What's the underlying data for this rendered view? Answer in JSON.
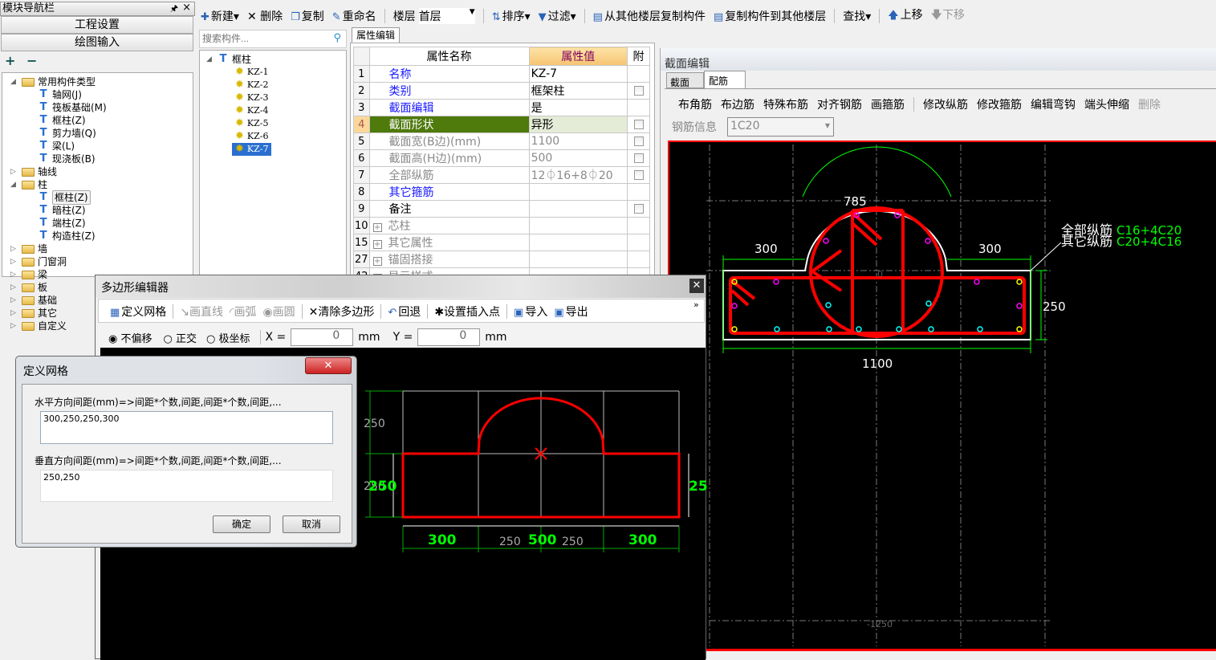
{
  "nav": {
    "title": "模块导航栏",
    "pin": "🖈",
    "close": "×",
    "project_settings": "工程设置",
    "drawing_input": "绘图输入",
    "expand": "+",
    "collapse": "−",
    "tree": [
      {
        "label": "常用构件类型",
        "level": 0,
        "expanded": true
      },
      {
        "label": "轴网(J)",
        "level": 1
      },
      {
        "label": "筏板基础(M)",
        "level": 1
      },
      {
        "label": "框柱(Z)",
        "level": 1
      },
      {
        "label": "剪力墙(Q)",
        "level": 1
      },
      {
        "label": "梁(L)",
        "level": 1
      },
      {
        "label": "现浇板(B)",
        "level": 1
      },
      {
        "label": "轴线",
        "level": 0
      },
      {
        "label": "柱",
        "level": 0,
        "expanded": true
      },
      {
        "label": "框柱(Z)",
        "level": 1,
        "selected": true
      },
      {
        "label": "暗柱(Z)",
        "level": 1
      },
      {
        "label": "端柱(Z)",
        "level": 1
      },
      {
        "label": "构造柱(Z)",
        "level": 1
      },
      {
        "label": "墙",
        "level": 0
      },
      {
        "label": "门窗洞",
        "level": 0
      },
      {
        "label": "梁",
        "level": 0
      },
      {
        "label": "板",
        "level": 0
      },
      {
        "label": "基础",
        "level": 0
      },
      {
        "label": "其它",
        "level": 0
      },
      {
        "label": "自定义",
        "level": 0
      }
    ]
  },
  "toolbar": {
    "new": "新建",
    "delete": "删除",
    "copy": "复制",
    "rename": "重命名",
    "floor_label": "楼层",
    "floor_value": "首层",
    "sort": "排序",
    "filter": "过滤",
    "copy_from_floor": "从其他楼层复制构件",
    "copy_to_floor": "复制构件到其他楼层",
    "find": "查找",
    "move_up": "上移",
    "move_down": "下移"
  },
  "components": {
    "search_placeholder": "搜索构件...",
    "root": "框柱",
    "items": [
      "KZ-1",
      "KZ-2",
      "KZ-3",
      "KZ-4",
      "KZ-5",
      "KZ-6",
      "KZ-7"
    ],
    "selected": "KZ-7"
  },
  "properties": {
    "tab": "属性编辑",
    "headers": {
      "name": "属性名称",
      "value": "属性值",
      "attach": "附"
    },
    "rows": [
      {
        "n": "1",
        "name": "名称",
        "value": "KZ-7"
      },
      {
        "n": "2",
        "name": "类别",
        "value": "框架柱"
      },
      {
        "n": "3",
        "name": "截面编辑",
        "value": "是"
      },
      {
        "n": "4",
        "name": "截面形状",
        "value": "异形"
      },
      {
        "n": "5",
        "name": "截面宽(B边)(mm)",
        "value": "1100"
      },
      {
        "n": "6",
        "name": "截面高(H边)(mm)",
        "value": "500"
      },
      {
        "n": "7",
        "name": "全部纵筋",
        "value": "12⏀16+8⏀20"
      },
      {
        "n": "8",
        "name": "其它箍筋",
        "value": ""
      },
      {
        "n": "9",
        "name": "备注",
        "value": ""
      },
      {
        "n": "10",
        "name": "芯柱",
        "value": ""
      },
      {
        "n": "15",
        "name": "其它属性",
        "value": ""
      },
      {
        "n": "27",
        "name": "锚固搭接",
        "value": ""
      },
      {
        "n": "42",
        "name": "显示样式",
        "value": ""
      }
    ]
  },
  "section_editor": {
    "title": "截面编辑",
    "tabs": [
      "截面",
      "配筋"
    ],
    "active_tab": "配筋",
    "tools": [
      "布角筋",
      "布边筋",
      "特殊布筋",
      "对齐钢筋",
      "画箍筋",
      "修改纵筋",
      "修改箍筋",
      "编辑弯钩",
      "端头伸缩",
      "删除"
    ],
    "rebar_info_label": "钢筋信息",
    "rebar_info_value": "1C20",
    "canvas": {
      "dim_left": "300",
      "dim_right": "300",
      "dim_arc": "785",
      "dim_height": "250",
      "dim_width": "1100",
      "label_all": "全部纵筋",
      "label_all_value": "C16+4C20",
      "label_other": "其它纵筋",
      "label_other_value": "C20+4C16",
      "origin": "0",
      "coord": "-1250"
    }
  },
  "polygon_editor": {
    "title": "多边形编辑器",
    "tools": {
      "define_grid": "定义网格",
      "line": "画直线",
      "arc": "画弧",
      "circle": "画圆",
      "clear": "清除多边形",
      "undo": "回退",
      "insert_point": "设置插入点",
      "import": "导入",
      "export": "导出"
    },
    "modes": [
      "不偏移",
      "正交",
      "极坐标"
    ],
    "selected_mode": "不偏移",
    "x_label": "X =",
    "x_value": "0",
    "y_label": "Y =",
    "y_value": "0",
    "unit": "mm",
    "canvas": {
      "v1": "250",
      "v2": "250",
      "v_green": "250",
      "v_right": "25",
      "h1": "300",
      "h2": "500",
      "h3": "300",
      "hg1": "250",
      "hg2": "250"
    }
  },
  "grid_dialog": {
    "title": "定义网格",
    "h_label": "水平方向间距(mm)=>间距*个数,间距,间距*个数,间距,...",
    "h_value": "300,250,250,300",
    "v_label": "垂直方向间距(mm)=>间距*个数,间距,间距*个数,间距,...",
    "v_value": "250,250",
    "ok": "确定",
    "cancel": "取消"
  },
  "colors": {
    "rebar": "#ff0000",
    "dimension": "#00ff00",
    "selection": "#2a6fd0",
    "highlight_row": "#4f7a0c"
  }
}
